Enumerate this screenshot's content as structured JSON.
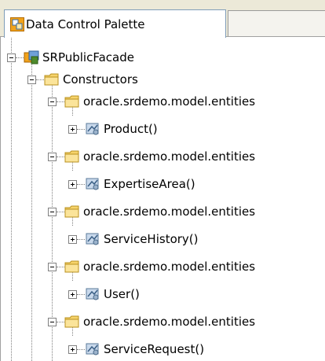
{
  "tab": {
    "active_label": "Data Control Palette",
    "icon": "data-control-palette-icon"
  },
  "tree": {
    "root": {
      "label": "SRPublicFacade",
      "icon": "data-control-icon",
      "state": "expanded"
    },
    "constructors": {
      "label": "Constructors",
      "icon": "folder-icon",
      "state": "expanded"
    },
    "packages": [
      {
        "label": "oracle.srdemo.model.entities",
        "icon": "folder-icon",
        "state": "expanded",
        "child": {
          "label": "Product()",
          "icon": "constructor-icon",
          "state": "collapsed"
        }
      },
      {
        "label": "oracle.srdemo.model.entities",
        "icon": "folder-icon",
        "state": "expanded",
        "child": {
          "label": "ExpertiseArea()",
          "icon": "constructor-icon",
          "state": "collapsed"
        }
      },
      {
        "label": "oracle.srdemo.model.entities",
        "icon": "folder-icon",
        "state": "expanded",
        "child": {
          "label": "ServiceHistory()",
          "icon": "constructor-icon",
          "state": "collapsed"
        }
      },
      {
        "label": "oracle.srdemo.model.entities",
        "icon": "folder-icon",
        "state": "expanded",
        "child": {
          "label": "User()",
          "icon": "constructor-icon",
          "state": "collapsed"
        }
      },
      {
        "label": "oracle.srdemo.model.entities",
        "icon": "folder-icon",
        "state": "expanded",
        "child": {
          "label": "ServiceRequest()",
          "icon": "constructor-icon",
          "state": "collapsed"
        }
      }
    ]
  }
}
